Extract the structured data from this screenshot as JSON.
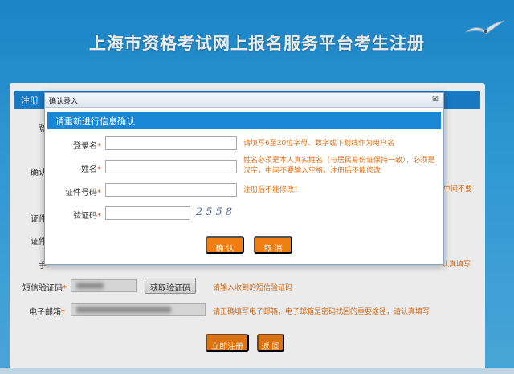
{
  "site": {
    "title": "上海市资格考试网上报名服务平台考生注册"
  },
  "background_form": {
    "panel_title": "注册",
    "labels": {
      "login": "登",
      "confirm": "确认",
      "cert_type": "证件",
      "cert_no": "证件",
      "phone": "手",
      "sms_code": "短信验证码",
      "email": "电子邮箱"
    },
    "required_mark": "*",
    "hints": {
      "name_tail": "中间不要",
      "phone_tail": "认真填写",
      "sms": "请输入收到的短信验证码",
      "email": "请正确填写电子邮箱，电子邮箱是密码找回的重要途径，请认真填写"
    },
    "buttons": {
      "get_code": "获取验证码",
      "register": "立即注册",
      "back": "返 回"
    }
  },
  "dialog": {
    "window_title": "确认录入",
    "close_glyph": "⊠",
    "banner": "请重新进行信息确认",
    "fields": {
      "login": {
        "label": "登录名",
        "value": "",
        "hint": "请填写6至20位字母、数字或下划线作为用户名"
      },
      "name": {
        "label": "姓名",
        "value": "",
        "hint": "姓名必须是本人真实姓名（与居民身份证保持一致），必须是汉字，中间不要输入空格，注册后不能修改"
      },
      "cert_no": {
        "label": "证件号码",
        "value": "",
        "hint": "注册后不能修改！"
      },
      "captcha": {
        "label": "验证码",
        "value": "",
        "image_text": "2558"
      }
    },
    "required_mark": "*",
    "buttons": {
      "confirm": "确 认",
      "cancel": "取 消"
    }
  },
  "colors": {
    "accent": "#1a86d6",
    "button": "#f07d11",
    "hint": "#e0741c"
  }
}
